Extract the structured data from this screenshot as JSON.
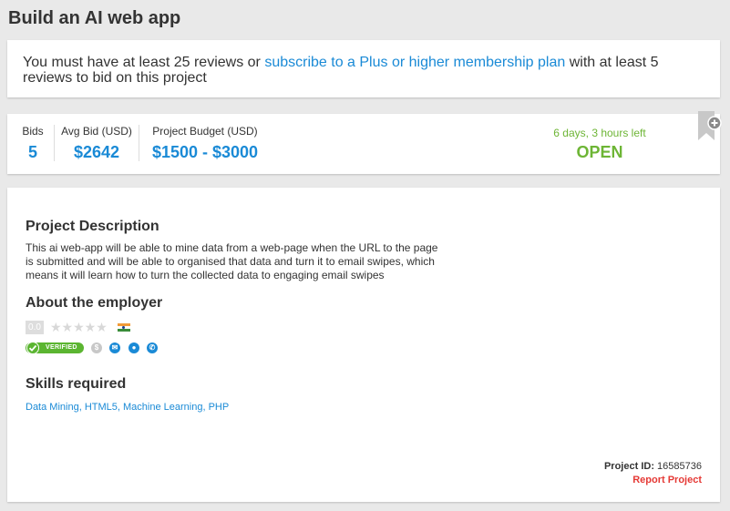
{
  "page": {
    "title": "Build an AI web app"
  },
  "notice": {
    "prefix": "You must have at least 25 reviews or ",
    "link": "subscribe to a Plus or higher membership plan",
    "suffix": " with at least 5 reviews to bid on this project"
  },
  "stats": {
    "bids_label": "Bids",
    "bids_value": "5",
    "avg_label": "Avg Bid (USD)",
    "avg_value": "$2642",
    "budget_label": "Project Budget (USD)",
    "budget_value": "$1500 - $3000",
    "time_left": "6 days, 3 hours left",
    "status": "OPEN"
  },
  "description": {
    "heading": "Project Description",
    "text": "This ai web-app will be able to mine data from a web-page when the URL to the page is submitted and will be able to organised that data and turn it to email swipes, which means it will learn how to turn the collected data to engaging email swipes"
  },
  "employer": {
    "heading": "About the employer",
    "rating": "0.0",
    "stars": "★★★★★",
    "verified_label": "VERIFIED",
    "icons": [
      "dollar-icon",
      "email-icon",
      "user-icon",
      "phone-icon"
    ]
  },
  "skills": {
    "heading": "Skills required",
    "items": [
      "Data Mining",
      "HTML5",
      "Machine Learning",
      "PHP"
    ]
  },
  "footer": {
    "project_id_label": "Project ID:",
    "project_id_value": "16585736",
    "report_label": "Report Project"
  },
  "colors": {
    "accent": "#1a8ad6",
    "success": "#6db535",
    "danger": "#e53935",
    "verified": "#5bb531"
  }
}
